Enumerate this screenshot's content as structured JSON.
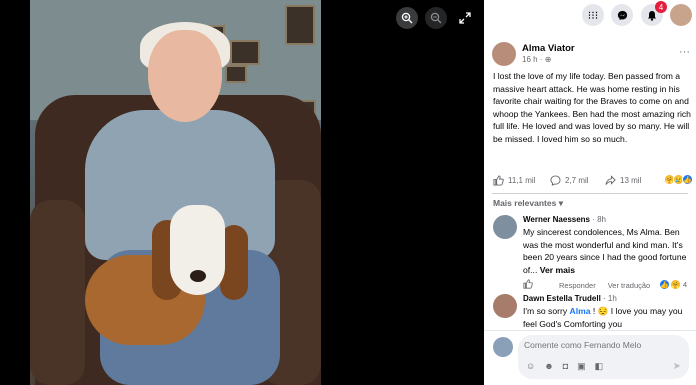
{
  "viewer": {
    "zoom_in_icon": "zoom-in-icon",
    "zoom_out_icon": "zoom-out-icon",
    "fullscreen_icon": "fullscreen-icon"
  },
  "topbar": {
    "menu_icon": "grid-menu-icon",
    "messenger_icon": "messenger-icon",
    "notifications_icon": "bell-icon",
    "notifications_badge": "4"
  },
  "post": {
    "author": "Alma Viator",
    "time": "16 h · ",
    "text": "I lost the love of my life today. Ben passed from a massive heart attack. He was home resting in his favorite chair waiting for the Braves to come on and whoop the Yankees. Ben had the most amazing rich full life. He loved and was loved by so many. He will be missed. I loved him so so much.",
    "likes": "11,1 mil",
    "comments": "2,7 mil",
    "shares": "13 mil"
  },
  "sort_label": "Mais relevantes",
  "comments": [
    {
      "name": "Werner Naessens",
      "time": " · 8h",
      "text": "My sincerest condolences, Ms Alma. Ben was the most wonderful and kind man. It's been 20 years since I had the good fortune of... ",
      "see_more": "Ver mais",
      "reply": "Responder",
      "translate": "Ver tradução",
      "reactions": "4"
    },
    {
      "name": "Dawn Estella Trudell",
      "time": " · 1h",
      "text_before": "I'm so sorry ",
      "mention": "Alma",
      "text_after": " ! 😔 I love you may you feel God's Comforting you"
    }
  ],
  "composer": {
    "placeholder": "Comente como Fernando Melo"
  },
  "colors": {
    "accent": "#1877f2",
    "badge": "#e41e3f",
    "text": "#050505",
    "muted": "#65676b"
  }
}
